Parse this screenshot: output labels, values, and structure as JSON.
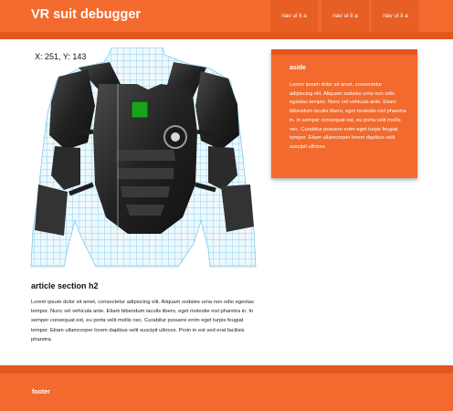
{
  "header": {
    "title": "VR suit debugger",
    "nav": [
      "nav ul li a",
      "nav ul li a",
      "nav ul li a"
    ]
  },
  "main": {
    "coordinates": "X: 251, Y: 143",
    "marker_color": "#1aa31a"
  },
  "aside": {
    "title": "aside",
    "text": "Lorem ipsum dolor sit amet, consectetur adipiscing elit. Aliquam sodales urna non odio egestas tempor. Nunc vel vehicula ante. Etiam bibendum iaculis libero, eget molestie nisl pharetra in. In semper consequat est, eu porta velit mollis nec. Curabitur posuere enim eget turpis feugiat tempor. Etiam ullamcorper lorem dapibus velit suscipit ultrices."
  },
  "article": {
    "title": "article section h2",
    "text": "Lorem ipsum dolor sit amet, consectetur adipiscing elit. Aliquam sodales urna non odio egestas tempor. Nunc vel vehicula ante. Etiam bibendum iaculis libero, eget molestie nisl pharetra in. In semper consequat est, eu porta velit mollis nec. Curabitur posuere enim eget turpis feugiat tempor. Etiam ullamcorper lorem dapibus velit suscipit ultrices. Proin in est sed erat facilisis pharetra."
  },
  "footer": {
    "label": "footer"
  },
  "colors": {
    "accent": "#f26a2e",
    "accent_dark": "#e2571f"
  }
}
